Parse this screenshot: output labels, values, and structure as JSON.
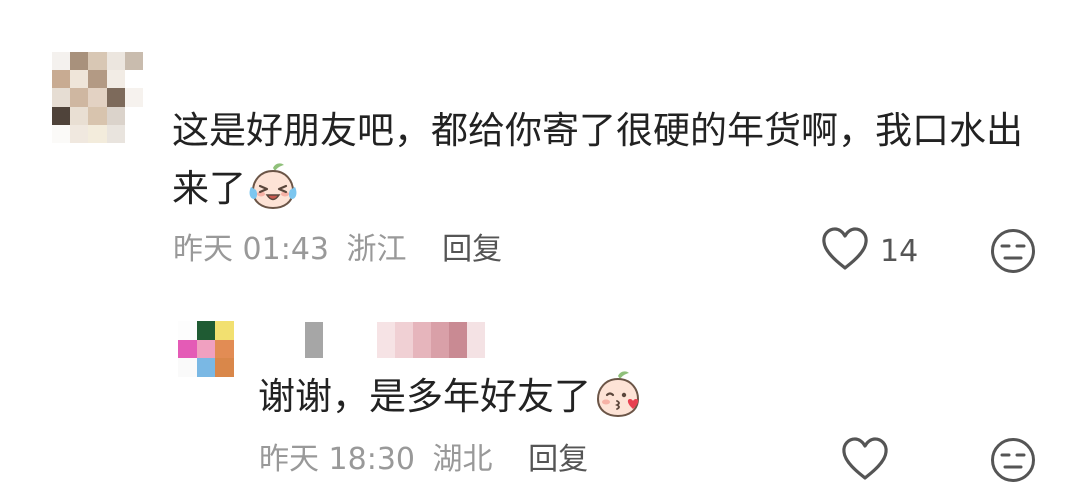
{
  "colors": {
    "text": "#222222",
    "meta": "#999999",
    "reply_button": "#555555",
    "icon": "#555555"
  },
  "comment": {
    "text": "这是好朋友吧，都给你寄了很硬的年货啊，我口水出来了",
    "emoji": "crying-laughing-peach-emoji",
    "time": "昨天 01:43",
    "location": "浙江",
    "reply_label": "回复",
    "likes": "14"
  },
  "reply": {
    "text": "谢谢，是多年好友了",
    "emoji": "kissing-peach-emoji",
    "time": "昨天 18:30",
    "location": "湖北",
    "reply_label": "回复"
  },
  "icons": {
    "like": "heart-outline-icon",
    "dislike": "expressionless-face-icon"
  }
}
